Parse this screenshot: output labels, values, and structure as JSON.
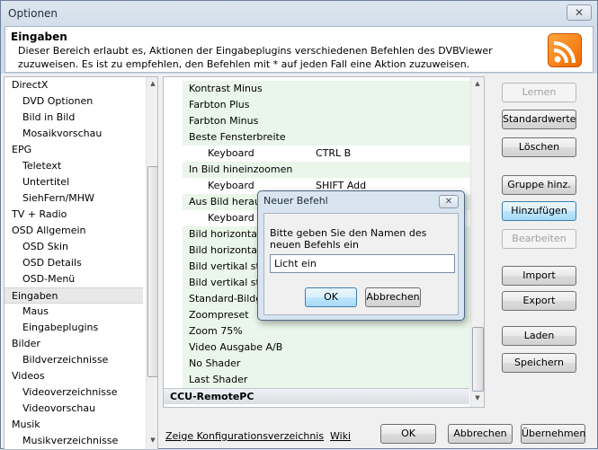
{
  "window": {
    "title": "Optionen",
    "close_label": "✕"
  },
  "header": {
    "title": "Eingaben",
    "description": "Dieser Bereich erlaubt es, Aktionen der Eingabeplugins verschiedenen Befehlen des DVBViewer zuzuweisen. Es ist zu empfehlen, den Befehlen mit * auf jeden Fall eine Aktion zuzuweisen.",
    "icon": "rss-icon"
  },
  "tree": {
    "items": [
      {
        "label": "DirectX",
        "level": 0
      },
      {
        "label": "DVD Optionen",
        "level": 1
      },
      {
        "label": "Bild in Bild",
        "level": 1
      },
      {
        "label": "Mosaikvorschau",
        "level": 1
      },
      {
        "label": "EPG",
        "level": 0
      },
      {
        "label": "Teletext",
        "level": 1
      },
      {
        "label": "Untertitel",
        "level": 1
      },
      {
        "label": "SiehFern/MHW",
        "level": 1
      },
      {
        "label": "TV + Radio",
        "level": 0
      },
      {
        "label": "OSD Allgemein",
        "level": 0
      },
      {
        "label": "OSD Skin",
        "level": 1
      },
      {
        "label": "OSD Details",
        "level": 1
      },
      {
        "label": "OSD-Menü",
        "level": 1
      },
      {
        "label": "Eingaben",
        "level": 0,
        "selected": true
      },
      {
        "label": "Maus",
        "level": 1
      },
      {
        "label": "Eingabeplugins",
        "level": 1
      },
      {
        "label": "Bilder",
        "level": 0
      },
      {
        "label": "Bildverzeichnisse",
        "level": 1
      },
      {
        "label": "Videos",
        "level": 0
      },
      {
        "label": "Videoverzeichnisse",
        "level": 1
      },
      {
        "label": "Videovorschau",
        "level": 1
      },
      {
        "label": "Musik",
        "level": 0
      },
      {
        "label": "Musikverzeichnisse",
        "level": 1
      }
    ]
  },
  "list": {
    "rows": [
      {
        "type": "cmd",
        "label": "Kontrast Minus"
      },
      {
        "type": "cmd",
        "label": "Farbton Plus"
      },
      {
        "type": "cmd",
        "label": "Farbton Minus"
      },
      {
        "type": "cmd",
        "label": "Beste Fensterbreite"
      },
      {
        "type": "kb",
        "label": "Keyboard",
        "key": "CTRL B"
      },
      {
        "type": "cmd",
        "label": "In Bild hineinzoomen"
      },
      {
        "type": "kb",
        "label": "Keyboard",
        "key": "SHIFT Add"
      },
      {
        "type": "cmd",
        "label": "Aus Bild herau"
      },
      {
        "type": "kb",
        "label": "Keyboard",
        "key": ""
      },
      {
        "type": "cmd",
        "label": "Bild horizontal"
      },
      {
        "type": "cmd",
        "label": "Bild horizontal"
      },
      {
        "type": "cmd",
        "label": "Bild vertikal st"
      },
      {
        "type": "cmd",
        "label": "Bild vertikal st"
      },
      {
        "type": "cmd",
        "label": "Standard-Bildg"
      },
      {
        "type": "cmd",
        "label": "Zoompreset"
      },
      {
        "type": "cmd",
        "label": "Zoom 75%"
      },
      {
        "type": "cmd",
        "label": "Video Ausgabe A/B"
      },
      {
        "type": "cmd",
        "label": "No Shader"
      },
      {
        "type": "cmd",
        "label": "Last Shader"
      },
      {
        "type": "grp",
        "label": "CCU-RemotePC"
      }
    ]
  },
  "buttons": {
    "lernen": "Lernen",
    "standardwerte": "Standardwerte",
    "loeschen": "Löschen",
    "gruppe": "Gruppe hinz.",
    "hinzufuegen": "Hinzufügen",
    "bearbeiten": "Bearbeiten",
    "import": "Import",
    "export": "Export",
    "laden": "Laden",
    "speichern": "Speichern",
    "ok": "OK",
    "abbrechen": "Abbrechen",
    "uebernehmen": "Übernehmen"
  },
  "links": {
    "config_dir": "Zeige Konfigurationsverzeichnis",
    "wiki": "Wiki"
  },
  "dialog": {
    "title": "Neuer Befehl",
    "close_label": "✕",
    "prompt": "Bitte geben Sie den Namen des neuen Befehls ein",
    "input_value": "Licht ein",
    "ok": "OK",
    "cancel": "Abbrechen"
  }
}
